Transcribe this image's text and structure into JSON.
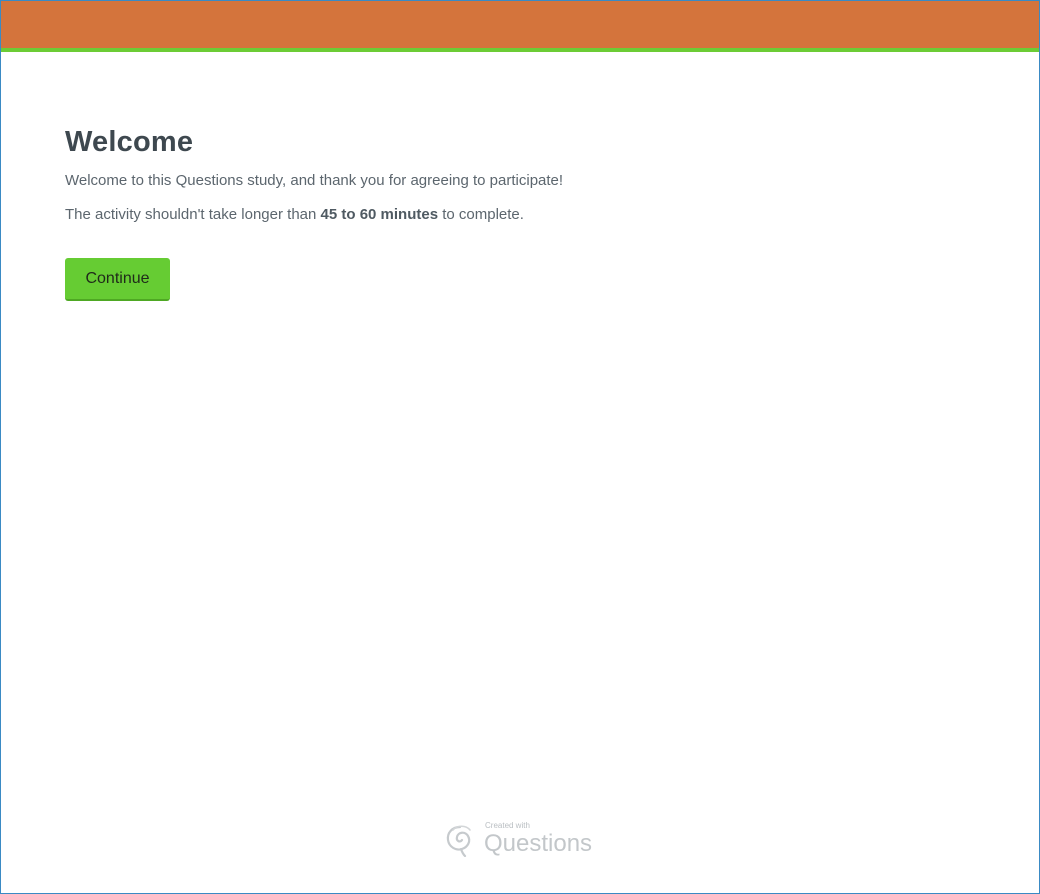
{
  "header": {
    "accent_color": "#d4743c",
    "underline_color": "#6ccc35"
  },
  "main": {
    "title": "Welcome",
    "intro": "Welcome to this Questions study, and thank you for agreeing to participate!",
    "duration_prefix": "The activity shouldn't take longer than ",
    "duration_value": "45 to 60 minutes",
    "duration_suffix": " to complete.",
    "continue_label": "Continue",
    "continue_color": "#66cc33"
  },
  "footer": {
    "created_with": "Created with",
    "brand": "Questions",
    "icon": "questions-swirl-logo-icon"
  }
}
